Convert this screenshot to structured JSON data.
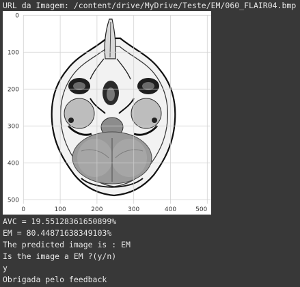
{
  "output": {
    "url_line": "URL da Imagem: /content/drive/MyDrive/Teste/EM/060_FLAIR04.bmp",
    "lines": [
      "AVC = 19.55128361650899%",
      "EM = 80.44871638349103%",
      "The predicted image is : EM",
      "Is the image a EM ?(y/n)",
      "y",
      "Obrigada pelo feedback"
    ]
  },
  "figure": {
    "x_ticks": [
      "0",
      "100",
      "200",
      "300",
      "400",
      "500"
    ],
    "y_ticks": [
      "0",
      "100",
      "200",
      "300",
      "400",
      "500"
    ],
    "xlim": [
      0,
      511
    ],
    "ylim": [
      511,
      0
    ],
    "grid": true,
    "image_subject": "axial brain MRI slice (FLAIR), displayed in inverted grayscale"
  },
  "colors": {
    "background": "#383838",
    "text": "#e6e6e6",
    "figure_bg": "#ffffff",
    "grid": "#cfcfcf"
  }
}
